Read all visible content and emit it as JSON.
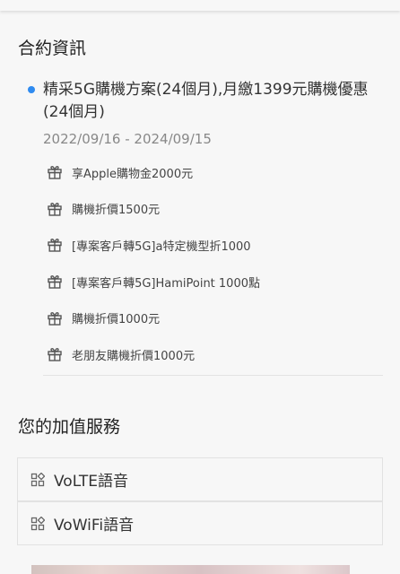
{
  "contract": {
    "title": "合約資訊",
    "plan_name": "精采5G購機方案(24個月),月繳1399元購機優惠(24個月)",
    "period": "2022/09/16 - 2024/09/15",
    "benefits": [
      {
        "label": "享Apple購物金2000元",
        "icon": "gift-icon"
      },
      {
        "label": "購機折價1500元",
        "icon": "gift-icon"
      },
      {
        "label": "[專案客戶轉5G]a特定機型折1000",
        "icon": "gift-icon"
      },
      {
        "label": "[專案客戶轉5G]HamiPoint 1000點",
        "icon": "gift-icon"
      },
      {
        "label": "購機折價1000元",
        "icon": "gift-icon"
      },
      {
        "label": "老朋友購機折價1000元",
        "icon": "gift-icon"
      }
    ]
  },
  "value_added_services": {
    "title": "您的加值服務",
    "items": [
      {
        "label": "VoLTE語音",
        "icon": "apps-grid-icon"
      },
      {
        "label": "VoWiFi語音",
        "icon": "apps-grid-icon"
      }
    ]
  },
  "colors": {
    "accent_dot": "#2f8bf0",
    "background": "#f7f7f7"
  }
}
